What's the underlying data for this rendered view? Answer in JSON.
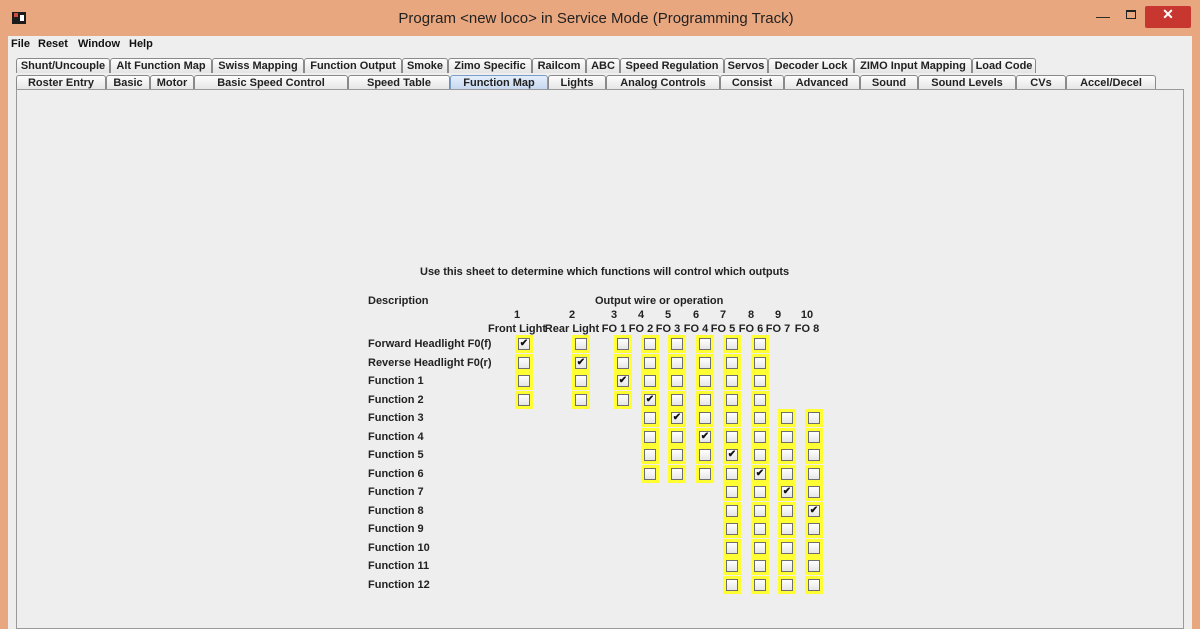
{
  "window": {
    "title": "Program <new loco> in Service Mode (Programming Track)"
  },
  "menubar": {
    "items": [
      "File",
      "Reset",
      "Window",
      "Help"
    ]
  },
  "tabs": {
    "row1": [
      "Shunt/Uncouple",
      "Alt Function Map",
      "Swiss Mapping",
      "Function Output",
      "Smoke",
      "Zimo Specific",
      "Railcom",
      "ABC",
      "Speed Regulation",
      "Servos",
      "Decoder Lock",
      "ZIMO Input Mapping",
      "Load Code"
    ],
    "row2": [
      "Roster Entry",
      "Basic",
      "Motor",
      "Basic Speed Control",
      "Speed Table",
      "Function Map",
      "Lights",
      "Analog Controls",
      "Consist",
      "Advanced",
      "Sound",
      "Sound Levels",
      "CVs",
      "Accel/Decel"
    ],
    "active": "Function Map"
  },
  "function_map": {
    "instruction": "Use this sheet to determine which functions will control which outputs",
    "description_header": "Description",
    "output_header": "Output wire or operation",
    "columns": [
      {
        "num": "1",
        "name": "Front Light"
      },
      {
        "num": "2",
        "name": "Rear Light"
      },
      {
        "num": "3",
        "name": "FO 1"
      },
      {
        "num": "4",
        "name": "FO 2"
      },
      {
        "num": "5",
        "name": "FO 3"
      },
      {
        "num": "6",
        "name": "FO 4"
      },
      {
        "num": "7",
        "name": "FO 5"
      },
      {
        "num": "8",
        "name": "FO 6"
      },
      {
        "num": "9",
        "name": "FO 7"
      },
      {
        "num": "10",
        "name": "FO 8"
      }
    ],
    "rows": [
      {
        "label": "Forward Headlight F0(f)",
        "cells": [
          1,
          0,
          0,
          0,
          0,
          0,
          0,
          0,
          null,
          null
        ]
      },
      {
        "label": "Reverse Headlight F0(r)",
        "cells": [
          0,
          1,
          0,
          0,
          0,
          0,
          0,
          0,
          null,
          null
        ]
      },
      {
        "label": "Function 1",
        "cells": [
          0,
          0,
          1,
          0,
          0,
          0,
          0,
          0,
          null,
          null
        ]
      },
      {
        "label": "Function 2",
        "cells": [
          0,
          0,
          0,
          1,
          0,
          0,
          0,
          0,
          null,
          null
        ]
      },
      {
        "label": "Function 3",
        "cells": [
          null,
          null,
          null,
          0,
          1,
          0,
          0,
          0,
          0,
          0
        ]
      },
      {
        "label": "Function 4",
        "cells": [
          null,
          null,
          null,
          0,
          0,
          1,
          0,
          0,
          0,
          0
        ]
      },
      {
        "label": "Function 5",
        "cells": [
          null,
          null,
          null,
          0,
          0,
          0,
          1,
          0,
          0,
          0
        ]
      },
      {
        "label": "Function 6",
        "cells": [
          null,
          null,
          null,
          0,
          0,
          0,
          0,
          1,
          0,
          0
        ]
      },
      {
        "label": "Function 7",
        "cells": [
          null,
          null,
          null,
          null,
          null,
          null,
          0,
          0,
          1,
          0
        ]
      },
      {
        "label": "Function 8",
        "cells": [
          null,
          null,
          null,
          null,
          null,
          null,
          0,
          0,
          0,
          1
        ]
      },
      {
        "label": "Function 9",
        "cells": [
          null,
          null,
          null,
          null,
          null,
          null,
          0,
          0,
          0,
          0
        ]
      },
      {
        "label": "Function 10",
        "cells": [
          null,
          null,
          null,
          null,
          null,
          null,
          0,
          0,
          0,
          0
        ]
      },
      {
        "label": "Function 11",
        "cells": [
          null,
          null,
          null,
          null,
          null,
          null,
          0,
          0,
          0,
          0
        ]
      },
      {
        "label": "Function 12",
        "cells": [
          null,
          null,
          null,
          null,
          null,
          null,
          0,
          0,
          0,
          0
        ]
      }
    ],
    "checkmark": "✔",
    "highlight_color": "#ffff33"
  }
}
